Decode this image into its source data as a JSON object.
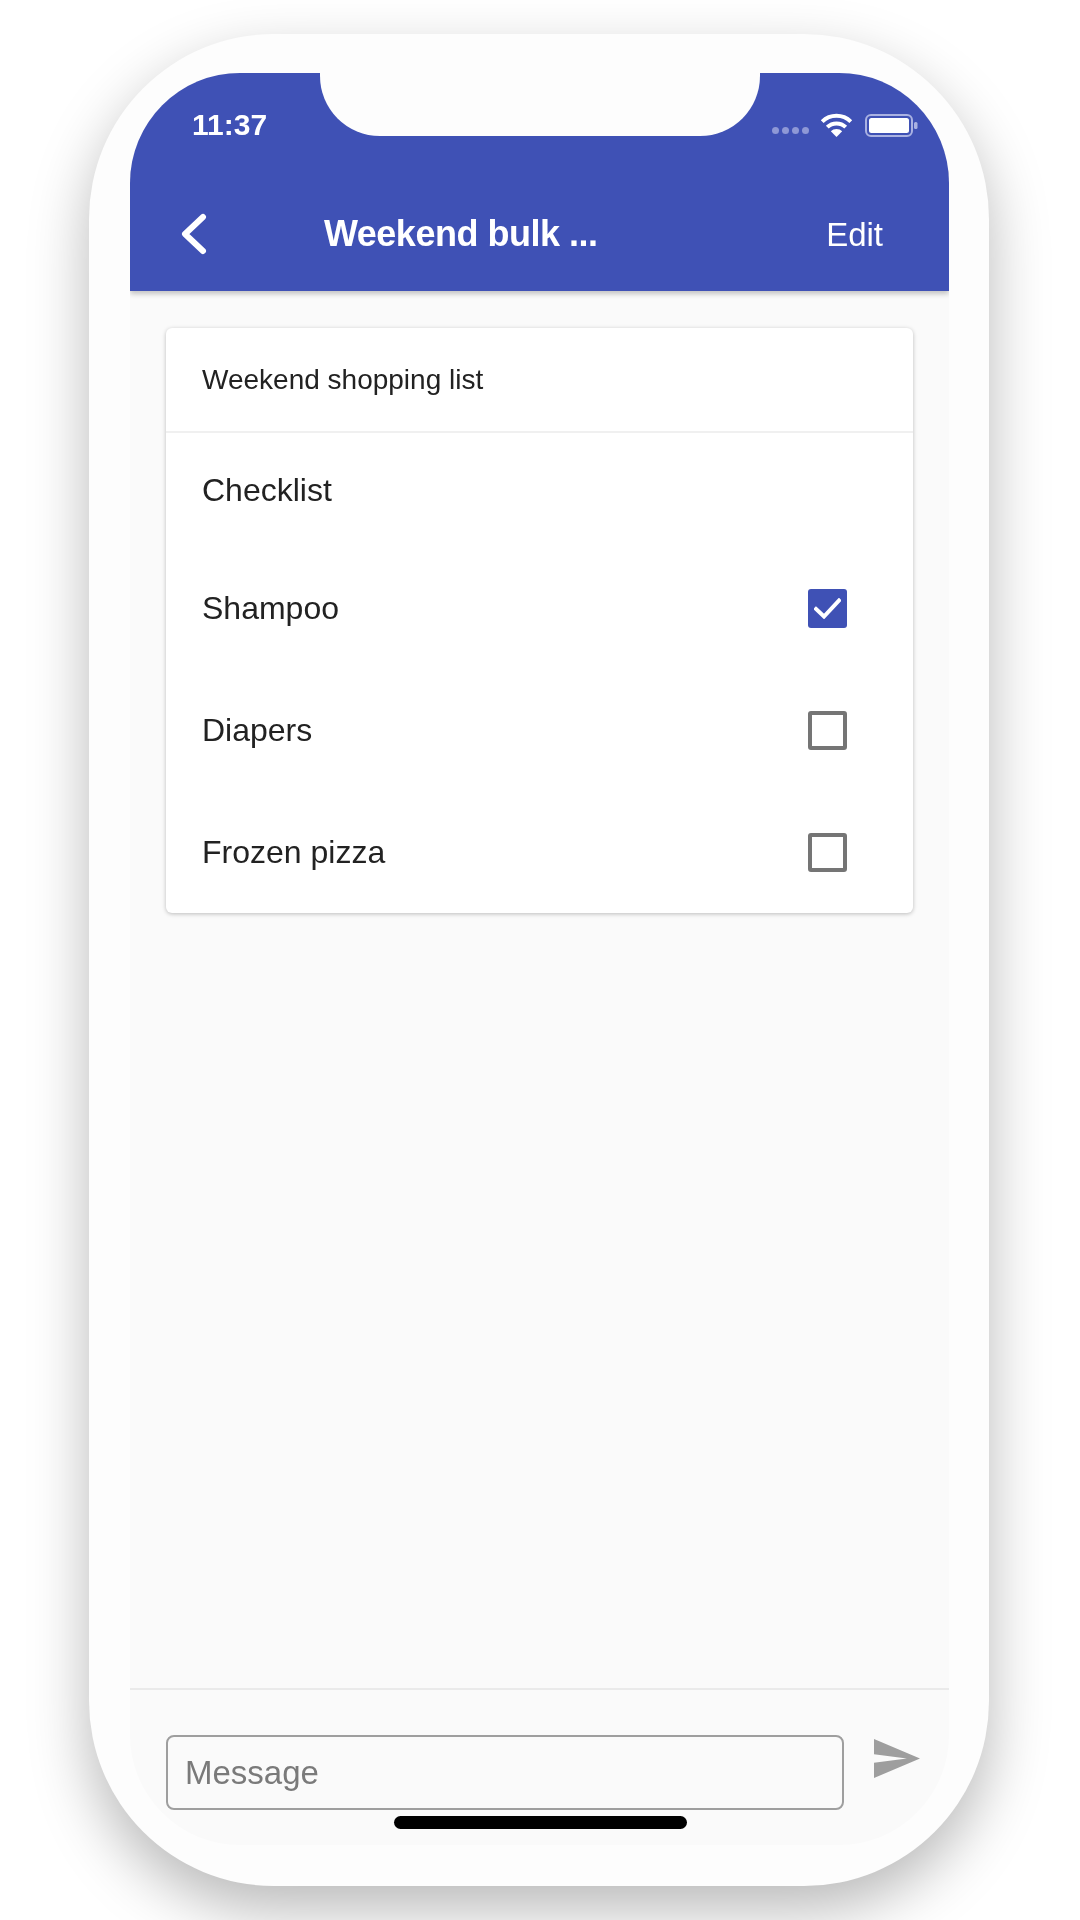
{
  "status_bar": {
    "time": "11:37"
  },
  "app_bar": {
    "title": "Weekend bulk ...",
    "action": "Edit"
  },
  "card": {
    "title": "Weekend shopping list",
    "section": "Checklist",
    "items": [
      {
        "label": "Shampoo",
        "checked": true
      },
      {
        "label": "Diapers",
        "checked": false
      },
      {
        "label": "Frozen pizza",
        "checked": false
      }
    ]
  },
  "composer": {
    "placeholder": "Message"
  }
}
